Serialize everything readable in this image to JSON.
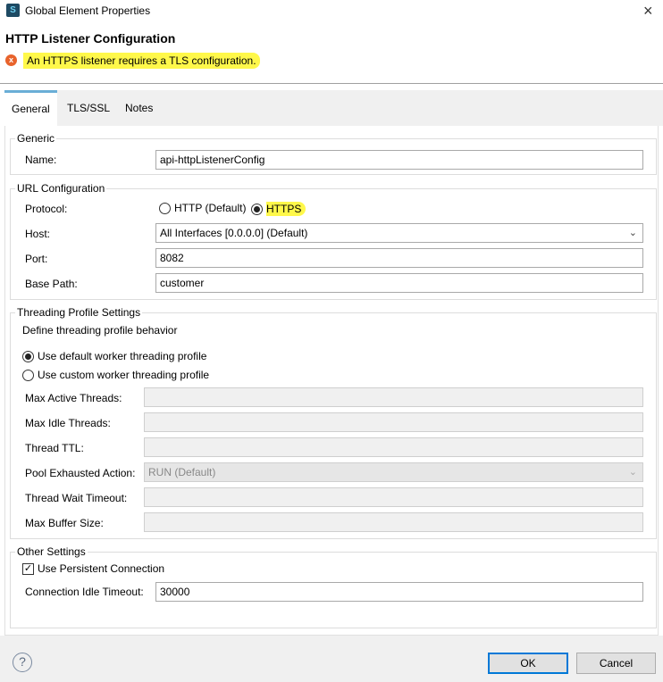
{
  "window": {
    "title": "Global Element Properties",
    "close_icon": "×"
  },
  "header": {
    "title": "HTTP Listener Configuration",
    "error": "An HTTPS listener requires a TLS configuration."
  },
  "tabs": [
    {
      "label": "General",
      "active": true
    },
    {
      "label": "TLS/SSL"
    },
    {
      "label": "Notes"
    }
  ],
  "generic": {
    "legend": "Generic",
    "name_label": "Name:",
    "name_value": "api-httpListenerConfig"
  },
  "url": {
    "legend": "URL Configuration",
    "protocol_label": "Protocol:",
    "protocol_options": [
      "HTTP (Default)",
      "HTTPS"
    ],
    "protocol_selected": "HTTPS",
    "host_label": "Host:",
    "host_value": "All Interfaces [0.0.0.0] (Default)",
    "port_label": "Port:",
    "port_value": "8082",
    "base_path_label": "Base Path:",
    "base_path_value": "customer"
  },
  "threading": {
    "legend": "Threading Profile Settings",
    "description": "Define threading profile behavior",
    "option_default": "Use default worker threading profile",
    "option_custom": "Use custom worker threading profile",
    "selected": "default",
    "max_active_label": "Max Active Threads:",
    "max_idle_label": "Max Idle Threads:",
    "ttl_label": "Thread TTL:",
    "pool_exhausted_label": "Pool Exhausted Action:",
    "pool_exhausted_value": "RUN (Default)",
    "wait_timeout_label": "Thread Wait Timeout:",
    "max_buffer_label": "Max Buffer Size:"
  },
  "other": {
    "legend": "Other Settings",
    "persistent_label": "Use Persistent Connection",
    "persistent_checked": true,
    "idle_timeout_label": "Connection Idle Timeout:",
    "idle_timeout_value": "30000"
  },
  "footer": {
    "help_icon": "?",
    "ok": "OK",
    "cancel": "Cancel"
  },
  "colors": {
    "highlight": "#fff84a",
    "tab_accent": "#6aaed6",
    "default_button_border": "#0078d7",
    "error_icon": "#e8632c"
  }
}
